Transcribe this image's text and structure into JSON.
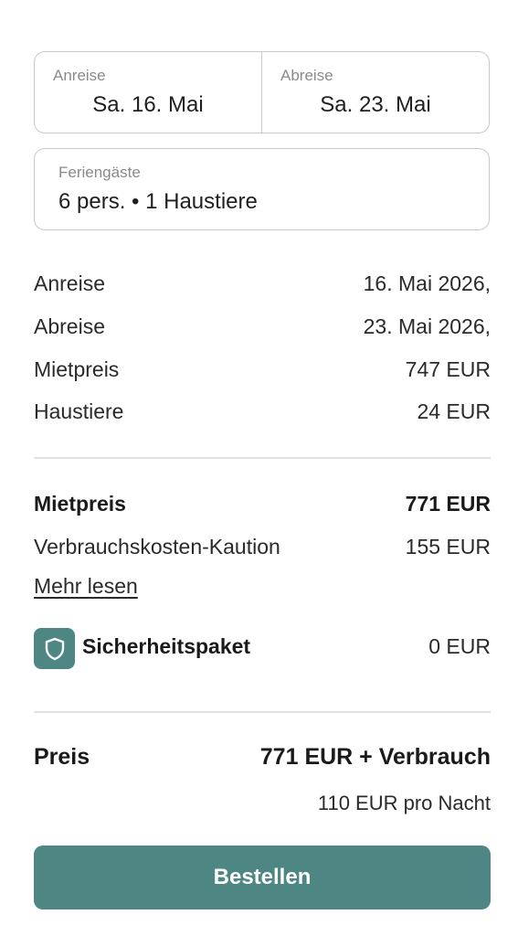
{
  "dates": {
    "arrival_label": "Anreise",
    "arrival_value": "Sa. 16. Mai",
    "departure_label": "Abreise",
    "departure_value": "Sa. 23. Mai"
  },
  "guests": {
    "label": "Feriengäste",
    "value": "6 pers. • 1 Haustiere"
  },
  "details": [
    {
      "label": "Anreise",
      "value": "16. Mai 2026,"
    },
    {
      "label": "Abreise",
      "value": "23. Mai 2026,"
    },
    {
      "label": "Mietpreis",
      "value": "747 EUR"
    },
    {
      "label": "Haustiere",
      "value": "24 EUR"
    }
  ],
  "totals": {
    "rent_label": "Mietpreis",
    "rent_value": "771 EUR",
    "deposit_label": "Verbrauchskosten-Kaution",
    "deposit_value": "155 EUR",
    "more_link": "Mehr lesen",
    "safety_label": "Sicherheitspaket",
    "safety_value": "0 EUR",
    "safety_icon": "shield-icon"
  },
  "price": {
    "label": "Preis",
    "value": "771 EUR + Verbrauch",
    "per_night": "110 EUR pro Nacht"
  },
  "order_button": "Bestellen",
  "colors": {
    "accent": "#4e8683",
    "border": "#c9c9c9",
    "divider": "#e3e3e3"
  }
}
